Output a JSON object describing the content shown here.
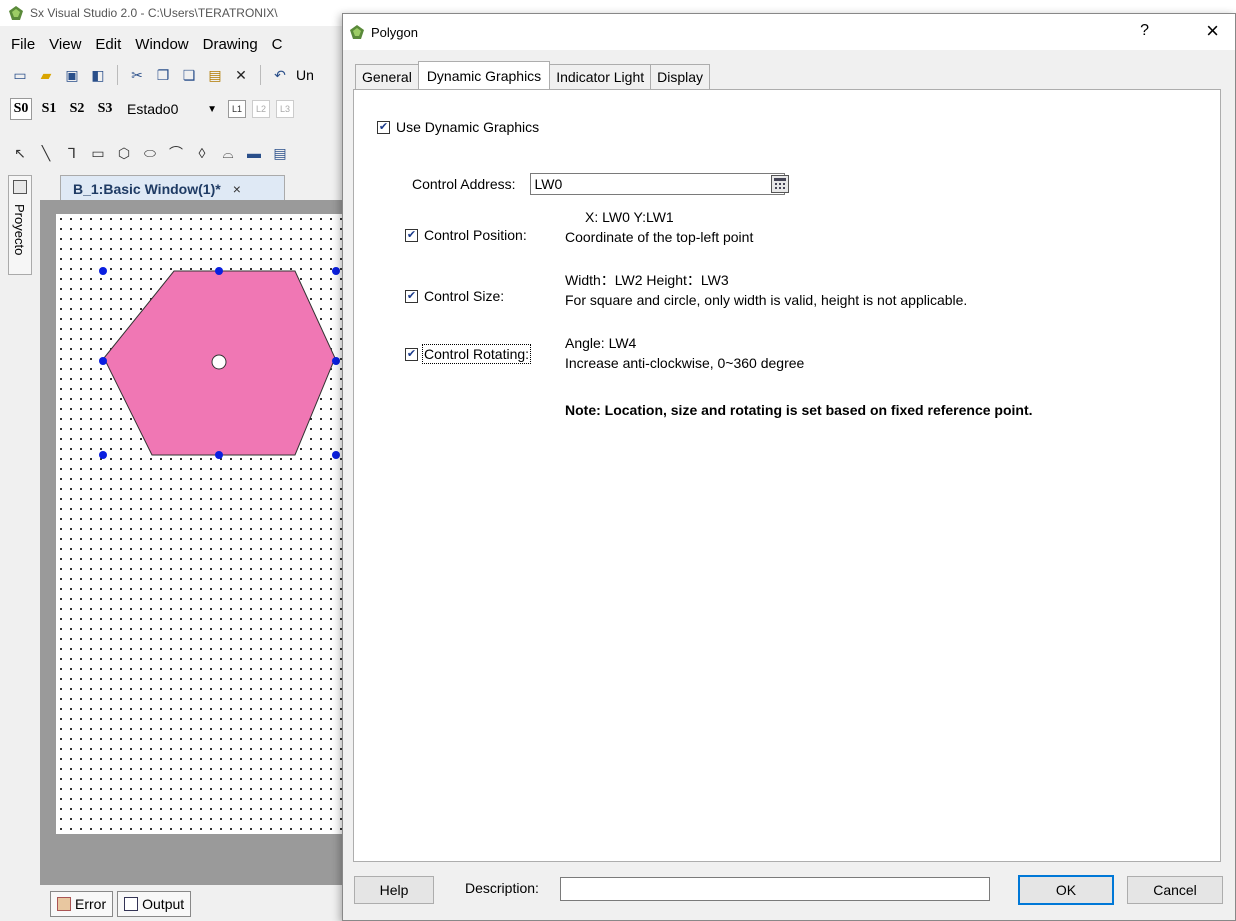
{
  "app": {
    "title": "Sx Visual Studio 2.0 - C:\\Users\\TERATRONIX\\",
    "menu": [
      "File",
      "View",
      "Edit",
      "Window",
      "Drawing",
      "C"
    ],
    "toolbar1": {
      "undo_label": "Un"
    },
    "toolbar2": {
      "states": [
        "S0",
        "S1",
        "S2",
        "S3"
      ],
      "state_combo": "Estado0",
      "layers": [
        "L1",
        "L2",
        "L3"
      ]
    },
    "side_panel": "Proyecto",
    "doc_tab": {
      "label": "B_1:Basic Window(1)*",
      "close": "×"
    },
    "bottom_tabs": [
      "Error",
      "Output"
    ]
  },
  "dialog": {
    "title": "Polygon",
    "help_symbol": "?",
    "close_symbol": "×",
    "tabs": [
      "General",
      "Dynamic Graphics",
      "Indicator Light",
      "Display"
    ],
    "active_tab": "Dynamic Graphics",
    "use_dynamic": {
      "label": "Use Dynamic Graphics",
      "checked": true
    },
    "control_address": {
      "label": "Control Address:",
      "value": "LW0"
    },
    "position": {
      "label": "Control Position:",
      "checked": true,
      "line1": "X: LW0   Y:LW1",
      "line2": "Coordinate of the top-left point"
    },
    "size": {
      "label": "Control Size:",
      "checked": true,
      "line1": "Width：LW2   Height：LW3",
      "line2": "For square and circle, only width is valid, height is not applicable."
    },
    "rotating": {
      "label": "Control Rotating:",
      "checked": true,
      "line1": "Angle: LW4",
      "line2": "Increase anti-clockwise, 0~360 degree"
    },
    "note": "Note: Location, size and rotating is set based on fixed reference point.",
    "footer": {
      "help": "Help",
      "description_label": "Description:",
      "description_value": "",
      "ok": "OK",
      "cancel": "Cancel"
    }
  },
  "colors": {
    "polygon_fill": "#f077b4",
    "handle": "#0a1fe0",
    "accent": "#0078d7"
  }
}
